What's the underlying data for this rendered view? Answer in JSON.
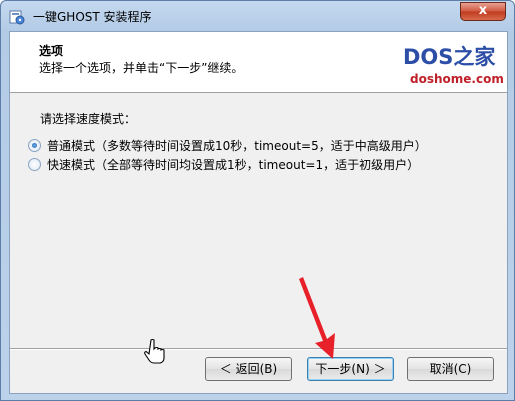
{
  "window": {
    "title": "一键GHOST 安装程序",
    "close_label": "x"
  },
  "header": {
    "title": "选项",
    "subtitle": "选择一个选项，并单击“下一步”继续。"
  },
  "logo": {
    "main": "DOS之家",
    "sub": "doshome.com"
  },
  "options": {
    "prompt": "请选择速度模式：",
    "items": [
      {
        "label": "普通模式（多数等待时间设置成10秒，timeout=5，适于中高级用户）",
        "checked": true
      },
      {
        "label": "快速模式（全部等待时间均设置成1秒，timeout=1，适于初级用户）",
        "checked": false
      }
    ]
  },
  "buttons": {
    "back": "＜ 返回(B)",
    "next": "下一步(N) ＞",
    "cancel": "取消(C)"
  },
  "colors": {
    "logo_blue": "#2c4ea6",
    "logo_red": "#c0202a",
    "annotation_arrow": "#e8202a"
  }
}
